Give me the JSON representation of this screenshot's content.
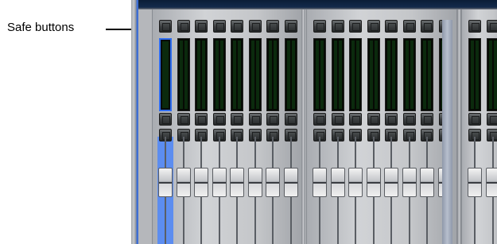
{
  "callout": {
    "label": "Safe buttons"
  },
  "console": {
    "colors": {
      "selection": "#2e6cf0",
      "meter_bg": "#060a04",
      "panel": "#c4c6c9",
      "top_bar": "#0b1d37"
    },
    "banks": [
      {
        "channel_count": 8,
        "selected_channel": 1
      },
      {
        "channel_count": 8
      },
      {
        "channel_count": 2
      }
    ],
    "icons": [
      "safe-button-icon",
      "channel-button-icon",
      "fader-icon",
      "meter-icon"
    ]
  }
}
